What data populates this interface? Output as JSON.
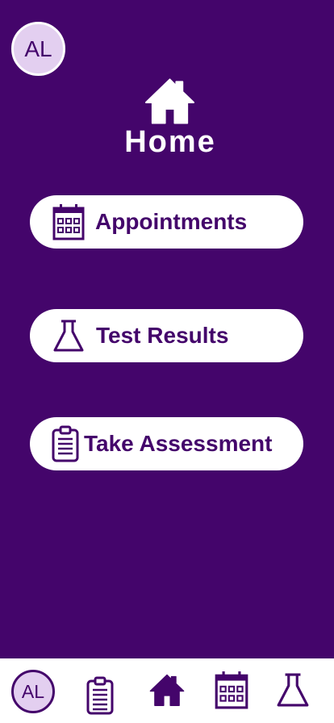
{
  "header": {
    "avatar_initials": "AL",
    "title": "Home",
    "title_icon": "home-icon"
  },
  "menu": [
    {
      "label": "Appointments",
      "icon": "calendar-icon"
    },
    {
      "label": "Test Results",
      "icon": "flask-icon"
    },
    {
      "label": "Take Assessment",
      "icon": "clipboard-icon"
    }
  ],
  "bottom_nav": {
    "avatar_initials": "AL",
    "tabs": [
      "clipboard-icon",
      "home-icon",
      "calendar-icon",
      "flask-icon"
    ]
  },
  "colors": {
    "background": "#44056b",
    "accent": "#44056b",
    "avatar_fill": "#e3cff0",
    "button": "#ffffff"
  }
}
